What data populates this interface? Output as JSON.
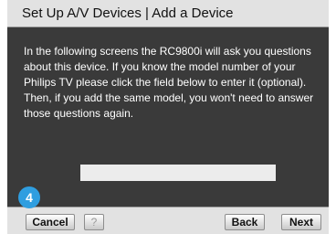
{
  "header": {
    "title": "Set Up A/V Devices | Add a Device"
  },
  "main": {
    "description": "In the following screens the RC9800i will ask you questions about this device. If you know the model number of your Philips TV please click the field below to enter it (optional). Then, if you add the same model, you won't need to answer those questions again.",
    "model_field": {
      "value": "",
      "placeholder": ""
    }
  },
  "step_badge": {
    "number": "4",
    "color": "#2f9ee0"
  },
  "footer": {
    "cancel_label": "Cancel",
    "help_label": "?",
    "back_label": "Back",
    "next_label": "Next"
  },
  "colors": {
    "panel": "#3a3a3a",
    "bar": "#e2e2e2",
    "text_on_panel": "#ffffff"
  }
}
